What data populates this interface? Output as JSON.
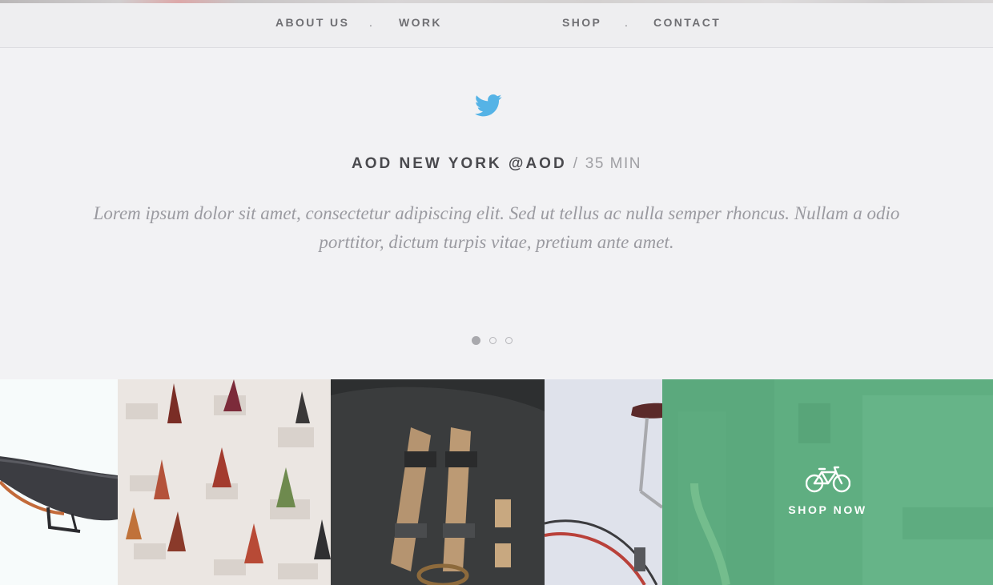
{
  "nav": {
    "items": [
      "ABOUT US",
      "WORK",
      "SHOP",
      "CONTACT"
    ],
    "separator": "."
  },
  "tweet": {
    "icon": "twitter-icon",
    "handle": "AOD NEW YORK @AOD",
    "separator": "/",
    "time": "35 MIN",
    "text": "Lorem ipsum dolor sit amet, consectetur adipiscing elit. Sed ut tellus ac nulla semper rhoncus. Nullam a odio porttitor, dictum turpis vitae, pretium ante amet.",
    "slides": 3,
    "active_slide": 1
  },
  "gallery": {
    "tiles": [
      "saddle-closeup-photo",
      "saddle-wall-display-photo",
      "leather-bag-straps-photo",
      "bicycle-photo",
      "shop-interior-photo"
    ],
    "cta_label": "SHOP NOW",
    "cta_icon": "bicycle-icon"
  },
  "colors": {
    "accent_twitter": "#55b3e6",
    "shop_overlay": "#62be8a"
  }
}
